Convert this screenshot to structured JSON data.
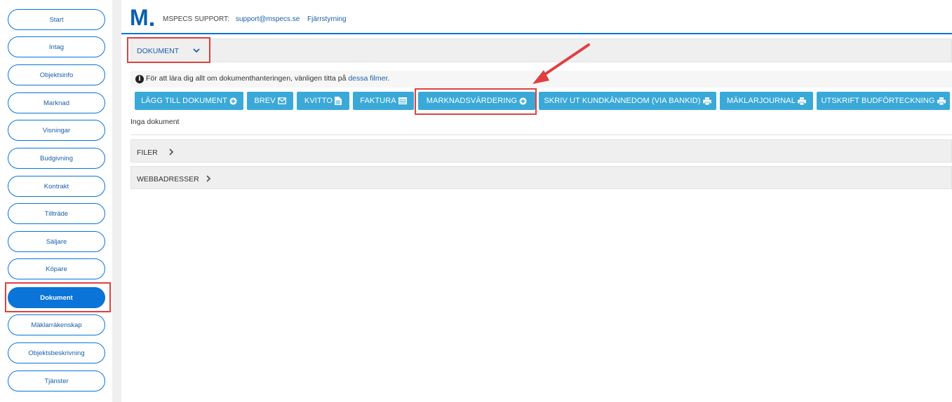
{
  "sidebar": {
    "items": [
      {
        "label": "Start"
      },
      {
        "label": "Intag"
      },
      {
        "label": "Objektsinfo"
      },
      {
        "label": "Marknad"
      },
      {
        "label": "Visningar"
      },
      {
        "label": "Budgivning"
      },
      {
        "label": "Kontrakt"
      },
      {
        "label": "Tillträde"
      },
      {
        "label": "Säljare"
      },
      {
        "label": "Köpare"
      },
      {
        "label": "Dokument"
      },
      {
        "label": "Mäklarräkenskap"
      },
      {
        "label": "Objektsbeskrivning"
      },
      {
        "label": "Tjänster"
      }
    ],
    "active": "Dokument"
  },
  "header": {
    "logo_text": "M",
    "support_label": "MSPECS SUPPORT:",
    "support_email": "support@mspecs.se",
    "remote_link": "Fjärrstyrning"
  },
  "documents": {
    "title": "DOKUMENT",
    "info_text": "För att lära dig allt om dokumenthanteringen, vänligen titta på",
    "info_link": "dessa filmer",
    "info_end": ".",
    "empty_text": "Inga dokument",
    "buttons": [
      {
        "label": "LÄGG TILL DOKUMENT",
        "icon": "plus-circle-icon"
      },
      {
        "label": "BREV",
        "icon": "envelope-icon"
      },
      {
        "label": "KVITTO",
        "icon": "file-icon"
      },
      {
        "label": "FAKTURA",
        "icon": "invoice-icon"
      },
      {
        "label": "MARKNADSVÄRDERING",
        "icon": "plus-circle-icon"
      },
      {
        "label": "SKRIV UT KUNDKÄNNEDOM (VIA BANKID)",
        "icon": "print-icon"
      },
      {
        "label": "MÄKLARJOURNAL",
        "icon": "print-icon"
      },
      {
        "label": "UTSKRIFT BUDFÖRTECKNING",
        "icon": "print-icon"
      }
    ]
  },
  "sections": {
    "files": "FILER",
    "web": "WEBBADRESSER"
  },
  "colors": {
    "accent": "#0a74d8",
    "button": "#3aa9d8",
    "highlight": "#e04040"
  }
}
